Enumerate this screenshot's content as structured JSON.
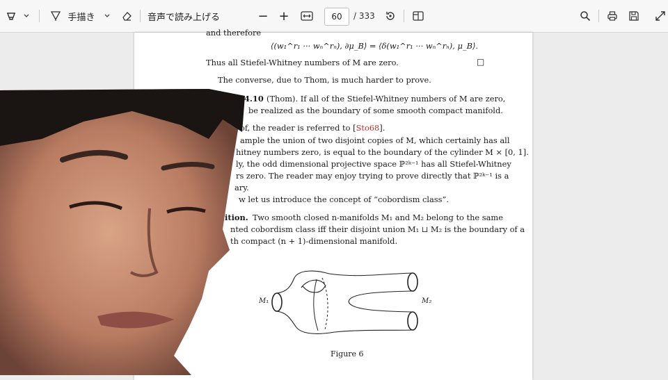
{
  "toolbar": {
    "handwriting_label": "手描き",
    "read_aloud_label": "音声で読み上げる",
    "zoom_out": "−",
    "zoom_in": "+",
    "page_number": "60",
    "page_total": "/ 333"
  },
  "document": {
    "line_and_therefore": "and therefore",
    "equation": "⟨(w₁^r₁ ··· wₙ^rₙ), ∂μ_B⟩ = ⟨δ(w₁^r₁ ··· wₙ^rₙ), μ_B⟩.",
    "line_thus": "Thus all Stiefel-Whitney numbers of M are zero.",
    "qed": "□",
    "line_converse": "The converse, due to Thom, is much harder to prove.",
    "theorem_num": "4.10",
    "theorem_line1": "(Thom).  If all of the Stiefel-Whitney numbers of M are zero,",
    "theorem_line2": "be realized as the boundary of some smooth compact manifold.",
    "proof_prefix": "of, the reader is referred to [",
    "proof_ref": "Sto68",
    "proof_suffix": "].",
    "ex_line1": "ample the union of two disjoint copies of M, which certainly has all",
    "ex_line2": "hitney numbers zero, is equal to the boundary of the cylinder M × [0, 1].",
    "ex_line3": "ly, the odd dimensional projective space ℙ²ᵏ⁻¹ has all Stiefel-Whitney",
    "ex_line4": "rs zero.  The reader may enjoy trying to prove directly that ℙ²ᵏ⁻¹ is a",
    "ex_line5": "ary.",
    "intro_line": "w let us introduce the concept of “cobordism class”.",
    "def_word": "ition.",
    "def_line1": "Two smooth closed n-manifolds M₁ and M₂ belong to the same",
    "def_line2": "nted cobordism class iff their disjoint union M₁ ⊔ M₂ is the boundary of a",
    "def_line3": "th compact (n + 1)-dimensional manifold.",
    "figure_m1": "M₁",
    "figure_m2": "M₂",
    "figure_caption": "Figure 6"
  }
}
